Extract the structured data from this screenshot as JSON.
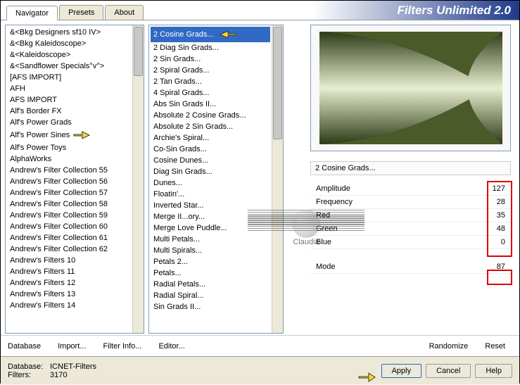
{
  "title": "Filters Unlimited 2.0",
  "tabs": [
    "Navigator",
    "Presets",
    "About"
  ],
  "leftList": [
    "&<Bkg Designers sf10 IV>",
    "&<Bkg Kaleidoscope>",
    "&<Kaleidoscope>",
    "&<Sandflower Specials°v°>",
    "[AFS IMPORT]",
    "AFH",
    "AFS IMPORT",
    "Alf's Border FX",
    "Alf's Power Grads",
    "Alf's Power Sines",
    "Alf's Power Toys",
    "AlphaWorks",
    "Andrew's Filter Collection 55",
    "Andrew's Filter Collection 56",
    "Andrew's Filter Collection 57",
    "Andrew's Filter Collection 58",
    "Andrew's Filter Collection 59",
    "Andrew's Filter Collection 60",
    "Andrew's Filter Collection 61",
    "Andrew's Filter Collection 62",
    "Andrew's Filters 10",
    "Andrew's Filters 11",
    "Andrew's Filters 12",
    "Andrew's Filters 13",
    "Andrew's Filters 14"
  ],
  "midList": [
    "2 Cosine Grads...",
    "2 Diag Sin Grads...",
    "2 Sin Grads...",
    "2 Spiral Grads...",
    "2 Tan Grads...",
    "4 Spiral Grads...",
    "Abs Sin Grads II...",
    "Absolute 2 Cosine Grads...",
    "Absolute 2 Sin Grads...",
    "Archie's Spiral...",
    "Co-Sin Grads...",
    "Cosine Dunes...",
    "Diag Sin Grads...",
    "Dunes...",
    "Floatin'...",
    "Inverted Star...",
    "Merge II...ory...",
    "Merge Love Puddle...",
    "Multi Petals...",
    "Multi Spirals...",
    "Petals 2...",
    "Petals...",
    "Radial Petals...",
    "Radial Spiral...",
    "Sin Grads II..."
  ],
  "midSelected": 0,
  "filterName": "2 Cosine Grads...",
  "params": [
    {
      "label": "Amplitude",
      "value": 127
    },
    {
      "label": "Frequency",
      "value": 28
    },
    {
      "label": "Red",
      "value": 35
    },
    {
      "label": "Green",
      "value": 48
    },
    {
      "label": "Blue",
      "value": 0
    }
  ],
  "modeParam": {
    "label": "Mode",
    "value": 87
  },
  "buttons": {
    "database": "Database",
    "import": "Import...",
    "filterInfo": "Filter Info...",
    "editor": "Editor...",
    "randomize": "Randomize",
    "reset": "Reset",
    "apply": "Apply",
    "cancel": "Cancel",
    "help": "Help"
  },
  "footer": {
    "dbLabel": "Database:",
    "dbValue": "ICNET-Filters",
    "filtersLabel": "Filters:",
    "filtersValue": "3170"
  }
}
